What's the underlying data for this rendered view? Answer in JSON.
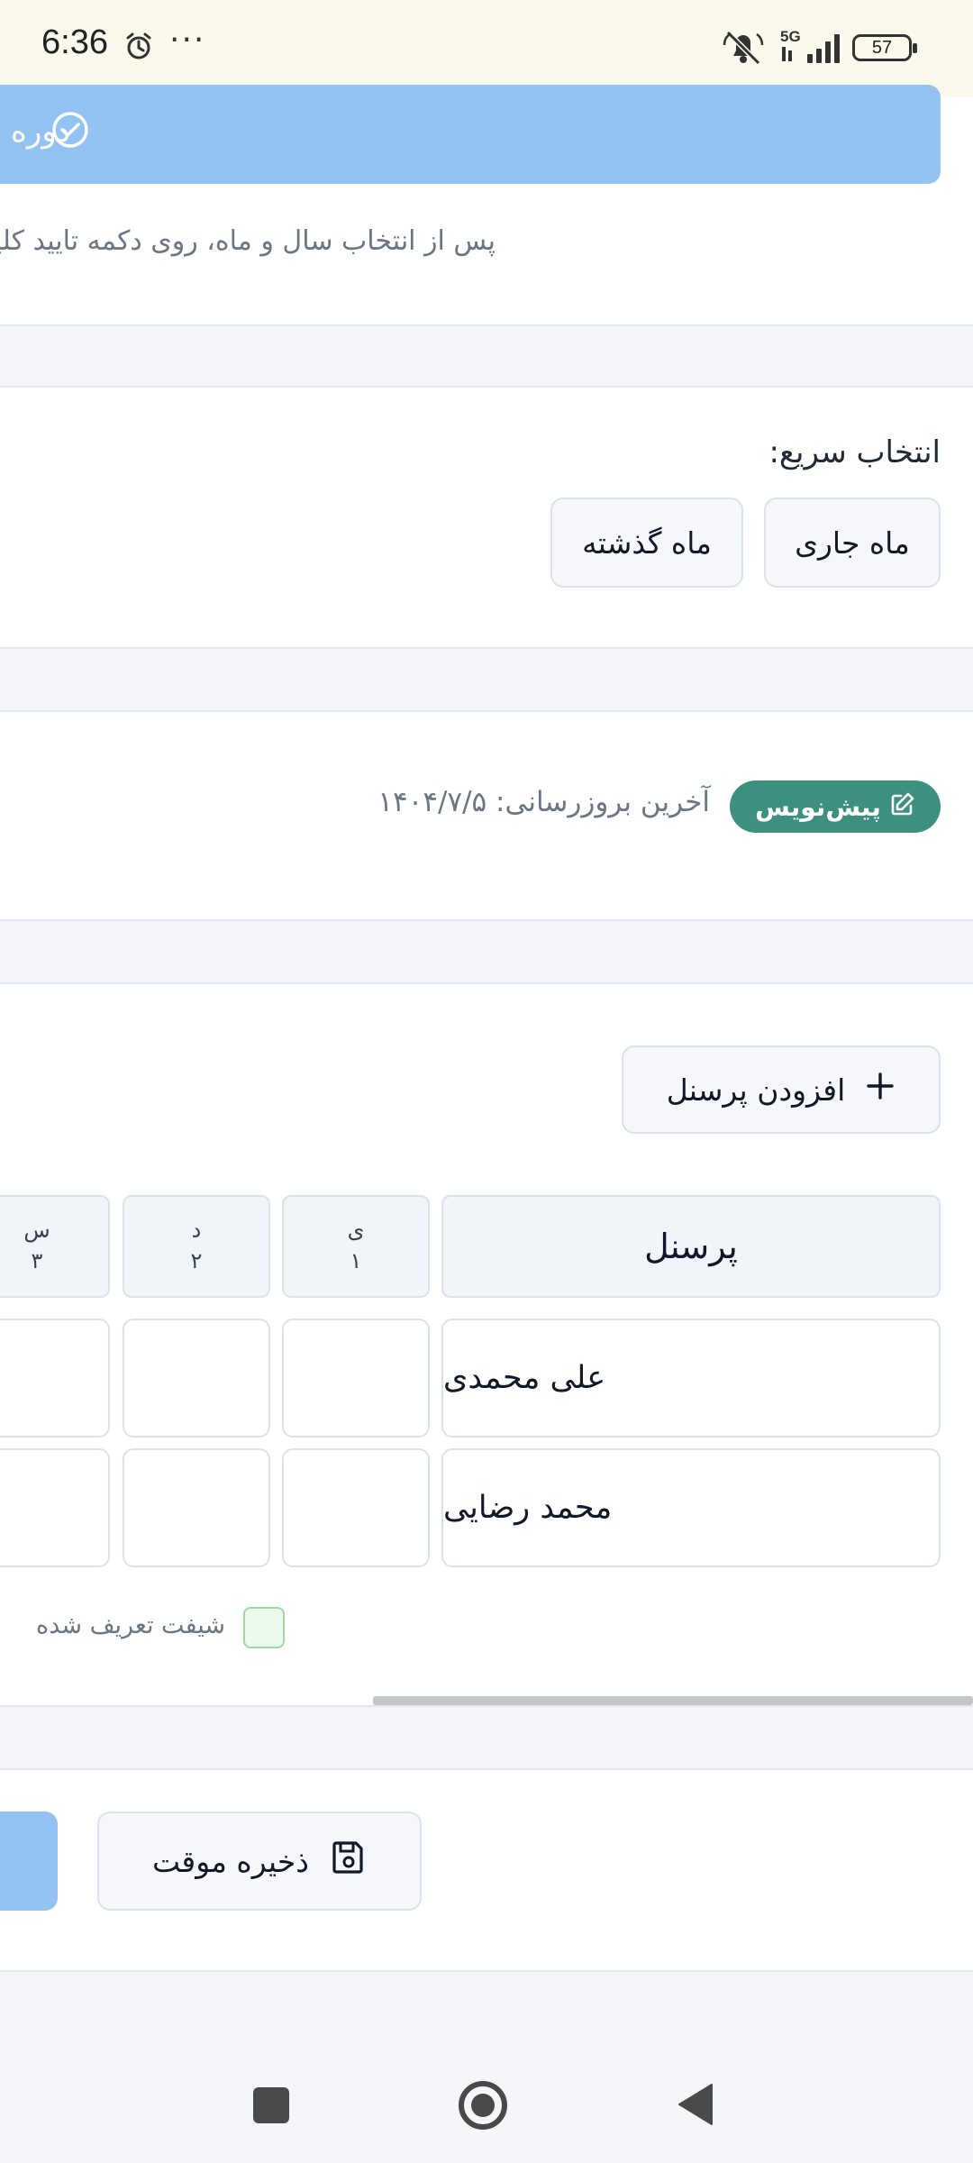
{
  "status_bar": {
    "time": "6:36",
    "dots": "···",
    "network": "5G",
    "battery": "57"
  },
  "period": {
    "button_label": "دوره",
    "help_text": "پس از انتخاب سال و ماه، روی دکمه تایید کلیک"
  },
  "quick_select": {
    "title": "انتخاب سریع:",
    "current_month": "ماه جاری",
    "last_month": "ماه گذشته"
  },
  "status": {
    "badge": "پیش‌نویس",
    "last_update": "آخرین بروزرسانی: ۱۴۰۴/۷/۵"
  },
  "staff": {
    "add_button": "افزودن پرسنل",
    "header_personnel": "پرسنل",
    "days": [
      {
        "letter": "ی",
        "num": "۱"
      },
      {
        "letter": "د",
        "num": "۲"
      },
      {
        "letter": "س",
        "num": "۳"
      }
    ],
    "rows": [
      "علی محمدی",
      "محمد رضایی"
    ],
    "legend": "شیفت تعریف شده"
  },
  "actions": {
    "save_temp": "ذخیره موقت"
  },
  "colors": {
    "primary_light": "#93c3f2",
    "badge_green": "#3d8f80",
    "legend_green": "#ecfaee"
  }
}
